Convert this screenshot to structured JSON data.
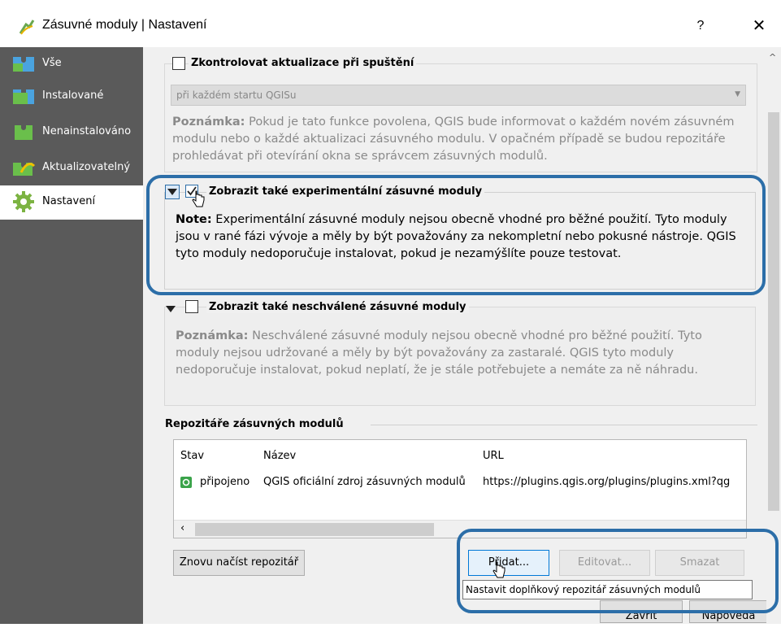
{
  "window": {
    "title": "Zásuvné moduly | Nastavení",
    "help_label": "?",
    "close_label": "✕"
  },
  "sidebar": {
    "items": [
      {
        "label": "Vše",
        "icon": "puzzle-all-icon"
      },
      {
        "label": "Instalované",
        "icon": "puzzle-installed-icon"
      },
      {
        "label": "Nenainstalováno",
        "icon": "puzzle-not-installed-icon"
      },
      {
        "label": "Aktualizovatelný",
        "icon": "puzzle-upgradeable-icon"
      },
      {
        "label": "Nastavení",
        "icon": "gear-icon",
        "active": true
      }
    ]
  },
  "updates": {
    "checkbox_label": "Zkontrolovat aktualizace při spuštění",
    "checked": false,
    "frequency_value": "při každém startu QGISu",
    "note_prefix": "Poznámka:",
    "note_text": " Pokud je tato funkce povolena, QGIS bude informovat o každém novém zásuvném modulu nebo o každé aktualizaci zásuvného modulu. V opačném případě se budou repozitáře prohledávat při otevírání okna se správcem zásuvných modulů."
  },
  "experimental": {
    "checkbox_label": "Zobrazit také experimentální zásuvné moduly",
    "checked": true,
    "note_prefix": "Note:",
    "note_text": " Experimentální zásuvné moduly nejsou obecně vhodné pro běžné použití. Tyto moduly jsou v rané fázi vývoje a měly by být považovány za nekompletní nebo pokusné nástroje. QGIS tyto moduly nedoporučuje instalovat, pokud je nezamýšlíte pouze testovat."
  },
  "deprecated": {
    "checkbox_label": "Zobrazit také neschválené zásuvné moduly",
    "checked": false,
    "note_prefix": "Poznámka:",
    "note_text": " Neschválené zásuvné moduly nejsou obecně vhodné pro běžné použití. Tyto moduly nejsou udržované a měly by být považovány za zastaralé. QGIS tyto moduly nedoporučuje instalovat, pokud neplatí, že je stále potřebujete a nemáte za ně náhradu."
  },
  "repositories": {
    "section_title": "Repozitáře zásuvných modulů",
    "columns": [
      "Stav",
      "Název",
      "URL"
    ],
    "rows": [
      {
        "status_icon": "connected-icon",
        "status": "připojeno",
        "name": "QGIS oficiální zdroj zásuvných modulů",
        "url": "https://plugins.qgis.org/plugins/plugins.xml?qg"
      }
    ],
    "reload_button": "Znovu načíst repozitář",
    "add_button": "Přidat...",
    "edit_button": "Editovat...",
    "delete_button": "Smazat",
    "tooltip": "Nastavit doplňkový repozitář zásuvných modulů"
  },
  "footer": {
    "close_button": "Zavřít",
    "help_button": "Nápověda"
  },
  "colors": {
    "sidebar_bg": "#5a5a5a",
    "highlight": "#2c6ea8",
    "note_gray": "#8a8a8a",
    "connected_green": "#3aa34a"
  }
}
